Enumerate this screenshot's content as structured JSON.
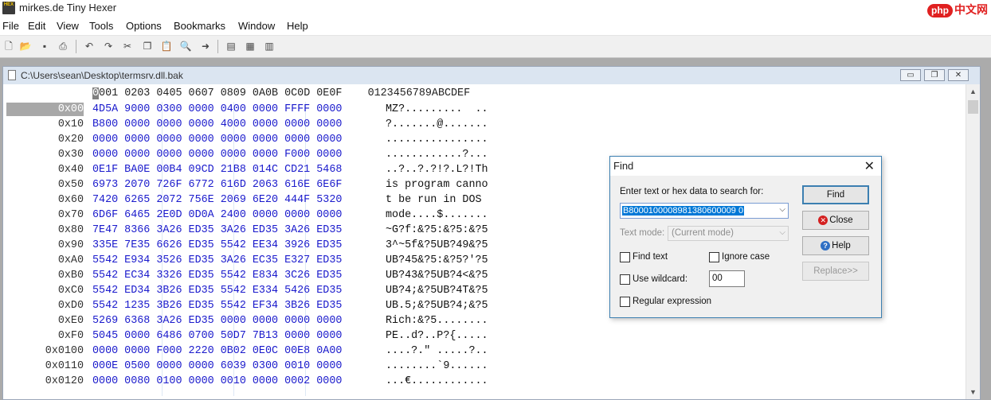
{
  "window": {
    "title": "mirkes.de Tiny Hexer",
    "icon_text": "HEX"
  },
  "watermark": {
    "brand": "php",
    "suffix": "中文网"
  },
  "menu": [
    "File",
    "Edit",
    "View",
    "Tools",
    "Options",
    "Bookmarks",
    "Window",
    "Help"
  ],
  "toolbar": {
    "icons": [
      "new-file-icon",
      "open-folder-icon",
      "save-icon",
      "print-icon",
      "undo-icon",
      "redo-icon",
      "cut-icon",
      "copy-icon",
      "paste-icon",
      "find-icon",
      "goto-icon",
      "view-hex-icon",
      "view-text-icon",
      "view-table-icon"
    ]
  },
  "document": {
    "path": "C:\\Users\\sean\\Desktop\\termsrv.dll.bak",
    "min_label": "▭",
    "max_label": "❐",
    "close_label": "✕",
    "header_cursor": "0",
    "header_hex": "001 0203 0405 0607 0809 0A0B 0C0D 0E0F",
    "header_ascii": "0123456789ABCDEF",
    "rows": [
      {
        "offset": "0x00",
        "hex": "4D5A 9000 0300 0000 0400 0000 FFFF 0000",
        "ascii": "MZ?.........  .."
      },
      {
        "offset": "0x10",
        "hex": "B800 0000 0000 0000 4000 0000 0000 0000",
        "ascii": "?.......@......."
      },
      {
        "offset": "0x20",
        "hex": "0000 0000 0000 0000 0000 0000 0000 0000",
        "ascii": "................"
      },
      {
        "offset": "0x30",
        "hex": "0000 0000 0000 0000 0000 0000 F000 0000",
        "ascii": "............?..."
      },
      {
        "offset": "0x40",
        "hex": "0E1F BA0E 00B4 09CD 21B8 014C CD21 5468",
        "ascii": "..?..?.?!?.L?!Th"
      },
      {
        "offset": "0x50",
        "hex": "6973 2070 726F 6772 616D 2063 616E 6E6F",
        "ascii": "is program canno"
      },
      {
        "offset": "0x60",
        "hex": "7420 6265 2072 756E 2069 6E20 444F 5320",
        "ascii": "t be run in DOS "
      },
      {
        "offset": "0x70",
        "hex": "6D6F 6465 2E0D 0D0A 2400 0000 0000 0000",
        "ascii": "mode....$......."
      },
      {
        "offset": "0x80",
        "hex": "7E47 8366 3A26 ED35 3A26 ED35 3A26 ED35",
        "ascii": "~G?f:&?5:&?5:&?5"
      },
      {
        "offset": "0x90",
        "hex": "335E 7E35 6626 ED35 5542 EE34 3926 ED35",
        "ascii": "3^~5f&?5UB?49&?5"
      },
      {
        "offset": "0xA0",
        "hex": "5542 E934 3526 ED35 3A26 EC35 E327 ED35",
        "ascii": "UB?45&?5:&?5?'?5"
      },
      {
        "offset": "0xB0",
        "hex": "5542 EC34 3326 ED35 5542 E834 3C26 ED35",
        "ascii": "UB?43&?5UB?4<&?5"
      },
      {
        "offset": "0xC0",
        "hex": "5542 ED34 3B26 ED35 5542 E334 5426 ED35",
        "ascii": "UB?4;&?5UB?4T&?5"
      },
      {
        "offset": "0xD0",
        "hex": "5542 1235 3B26 ED35 5542 EF34 3B26 ED35",
        "ascii": "UB.5;&?5UB?4;&?5"
      },
      {
        "offset": "0xE0",
        "hex": "5269 6368 3A26 ED35 0000 0000 0000 0000",
        "ascii": "Rich:&?5........"
      },
      {
        "offset": "0xF0",
        "hex": "5045 0000 6486 0700 50D7 7B13 0000 0000",
        "ascii": "PE..d?..P?{....."
      },
      {
        "offset": "0x0100",
        "hex": "0000 0000 F000 2220 0B02 0E0C 00E8 0A00",
        "ascii": "....?.\" .....?.."
      },
      {
        "offset": "0x0110",
        "hex": "000E 0500 0000 0000 6039 0300 0010 0000",
        "ascii": "........`9......"
      },
      {
        "offset": "0x0120",
        "hex": "0000 0080 0100 0000 0010 0000 0002 0000",
        "ascii": "...€............"
      }
    ]
  },
  "find_dialog": {
    "title": "Find",
    "close_label": "✕",
    "prompt": "Enter text or hex data to search for:",
    "search_value": "B8000100008981380600009 0",
    "text_mode_label": "Text mode:",
    "text_mode_value": "(Current mode)",
    "find_text_label": "Find text",
    "ignore_case_label": "Ignore case",
    "wildcard_label": "Use wildcard:",
    "wildcard_value": "00",
    "regex_label": "Regular expression",
    "find_button": "Find",
    "close_button": "Close",
    "help_button": "Help",
    "replace_button": "Replace>>"
  }
}
